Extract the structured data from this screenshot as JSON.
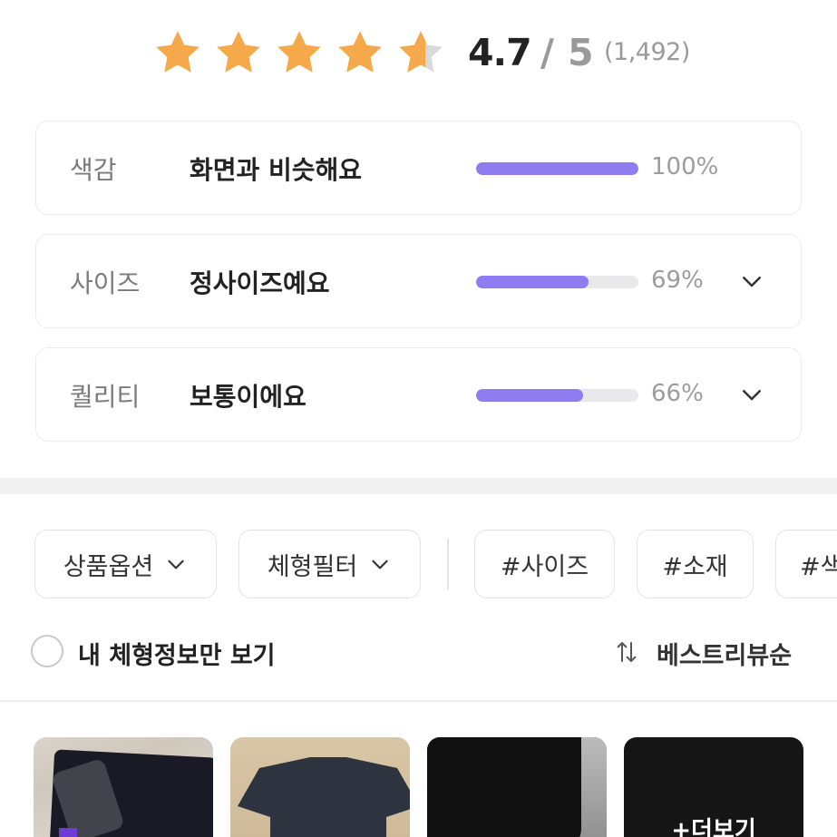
{
  "rating": {
    "score": "4.7",
    "separator": "/",
    "max": "5",
    "count": "(1,492)",
    "stars_value": 4.7,
    "star_color": "#F5A94A",
    "star_empty_color": "#D9D9D9"
  },
  "attributes": [
    {
      "name": "색감",
      "value": "화면과 비슷해요",
      "percent_label": "100%",
      "percent": 100,
      "expandable": false
    },
    {
      "name": "사이즈",
      "value": "정사이즈예요",
      "percent_label": "69%",
      "percent": 69,
      "expandable": true
    },
    {
      "name": "퀄리티",
      "value": "보통이에요",
      "percent_label": "66%",
      "percent": 66,
      "expandable": true
    }
  ],
  "bar_color": "#8E7CF0",
  "filters": {
    "option": "상품옵션",
    "body": "체형필터",
    "tags": [
      "#사이즈",
      "#소재",
      "#색"
    ]
  },
  "body_info_only": "내 체형정보만 보기",
  "sort_label": "베스트리뷰순",
  "more_label": "+더보기"
}
